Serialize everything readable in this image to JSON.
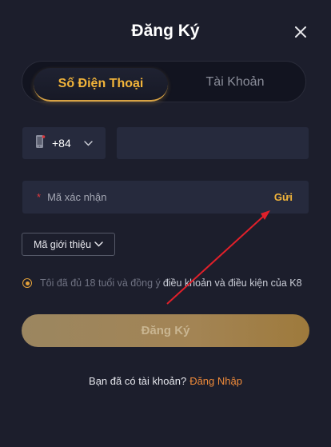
{
  "header": {
    "title": "Đăng Ký",
    "close_icon": "close-icon"
  },
  "tabs": [
    {
      "label": "Số Điện Thoại",
      "active": true
    },
    {
      "label": "Tài Khoản",
      "active": false
    }
  ],
  "phone": {
    "country_icon": "phone-icon",
    "country_code": "+84",
    "value": "",
    "placeholder": ""
  },
  "otp": {
    "required_mark": "*",
    "placeholder": "Mã xác nhận",
    "send_label": "Gửi"
  },
  "referral": {
    "label": "Mã giới thiệu"
  },
  "agreement": {
    "checked": true,
    "text": "Tôi đã đủ 18 tuổi và đồng ý",
    "link": "điều khoản và điều kiện của K8"
  },
  "submit": {
    "label": "Đăng Ký"
  },
  "footer": {
    "prompt": "Bạn đã có tài khoản?",
    "login_link": "Đăng Nhập"
  },
  "colors": {
    "accent": "#f2b43a",
    "background": "#1c1e2c",
    "field": "#262a3d",
    "annotation_arrow": "#e0202a",
    "login_link": "#ee8a3a"
  }
}
